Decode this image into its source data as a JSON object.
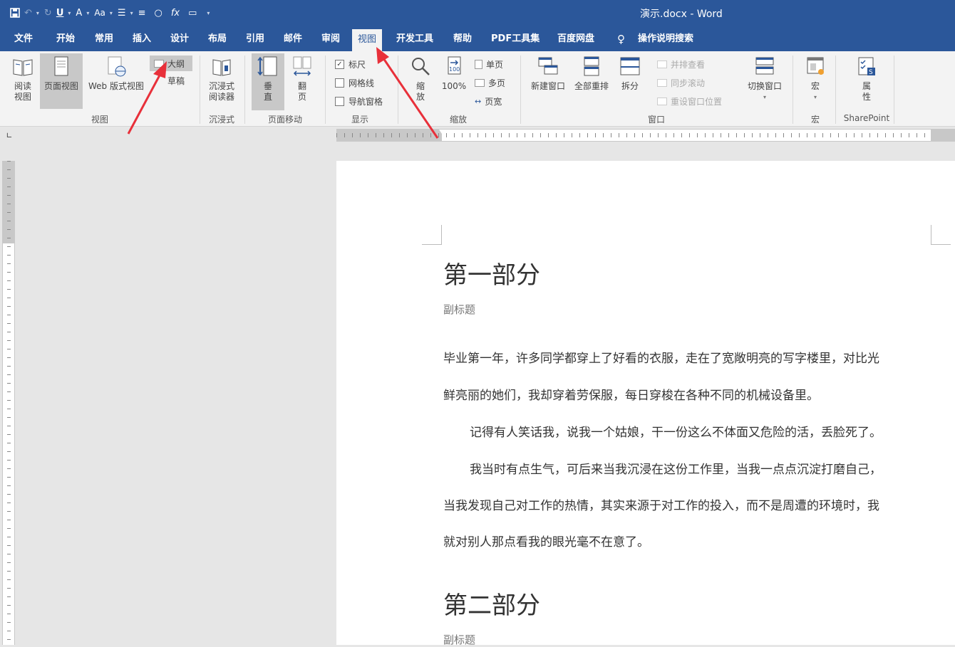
{
  "window": {
    "title": "演示.docx  -  Word"
  },
  "tabs": [
    "文件",
    "开始",
    "常用",
    "插入",
    "设计",
    "布局",
    "引用",
    "邮件",
    "审阅",
    "视图",
    "开发工具",
    "帮助",
    "PDF工具集",
    "百度网盘",
    "操作说明搜索"
  ],
  "active_tab": "视图",
  "ribbon": {
    "views": {
      "read": "阅读\n视图",
      "print_layout": "页面视图",
      "web_layout": "Web 版式视图",
      "outline": "大纲",
      "draft": "草稿",
      "group": "视图"
    },
    "immersive": {
      "reader": "沉浸式\n阅读器",
      "group": "沉浸式"
    },
    "page_movement": {
      "vertical": "垂\n直",
      "side": "翻\n页",
      "group": "页面移动"
    },
    "show": {
      "ruler": "标尺",
      "gridlines": "网格线",
      "nav_pane": "导航窗格",
      "ruler_checked": true,
      "gridlines_checked": false,
      "nav_pane_checked": false,
      "group": "显示"
    },
    "zoom": {
      "zoom": "缩\n放",
      "hundred": "100%",
      "one_page": "单页",
      "multi_page": "多页",
      "page_width": "页宽",
      "group": "缩放"
    },
    "window": {
      "new_window": "新建窗口",
      "arrange_all": "全部重排",
      "split": "拆分",
      "side_by_side": "并排查看",
      "sync_scroll": "同步滚动",
      "reset_pos": "重设窗口位置",
      "switch": "切换窗口",
      "group": "窗口"
    },
    "macros": {
      "macros": "宏",
      "group": "宏"
    },
    "sharepoint": {
      "properties": "属\n性",
      "group": "SharePoint"
    }
  },
  "document": {
    "heading1": "第一部分",
    "subtitle1": "副标题",
    "p1_line1": "毕业第一年，许多同学都穿上了好看的衣服，走在了宽敞明亮的写字楼里，对比光",
    "p1_line2": "鲜亮丽的她们，我却穿着劳保服，每日穿梭在各种不同的机械设备里。",
    "p2_line1": "记得有人笑话我，说我一个姑娘，干一份这么不体面又危险的活，丢脸死了。",
    "p3_line1": "我当时有点生气，可后来当我沉浸在这份工作里，当我一点点沉淀打磨自己，",
    "p3_line2": "当我发现自己对工作的热情，其实来源于对工作的投入，而不是周遭的环境时，我",
    "p3_line3": "就对别人那点看我的眼光毫不在意了。",
    "heading2": "第二部分",
    "subtitle2": "副标题"
  },
  "icons": {
    "save": "save-icon",
    "undo": "undo-icon",
    "redo": "redo-icon",
    "underline": "underline-icon",
    "font_color": "font-color-icon",
    "change_case": "change-case-icon",
    "bullets": "bullets-icon",
    "align": "align-icon",
    "shape": "circle-icon",
    "formula": "fx-icon",
    "comment": "comment-icon",
    "customize": "customize-qat-icon",
    "search": "lightbulb-icon"
  },
  "colors": {
    "title_bar": "#2b579a",
    "annotation_arrow": "#e8303a"
  }
}
